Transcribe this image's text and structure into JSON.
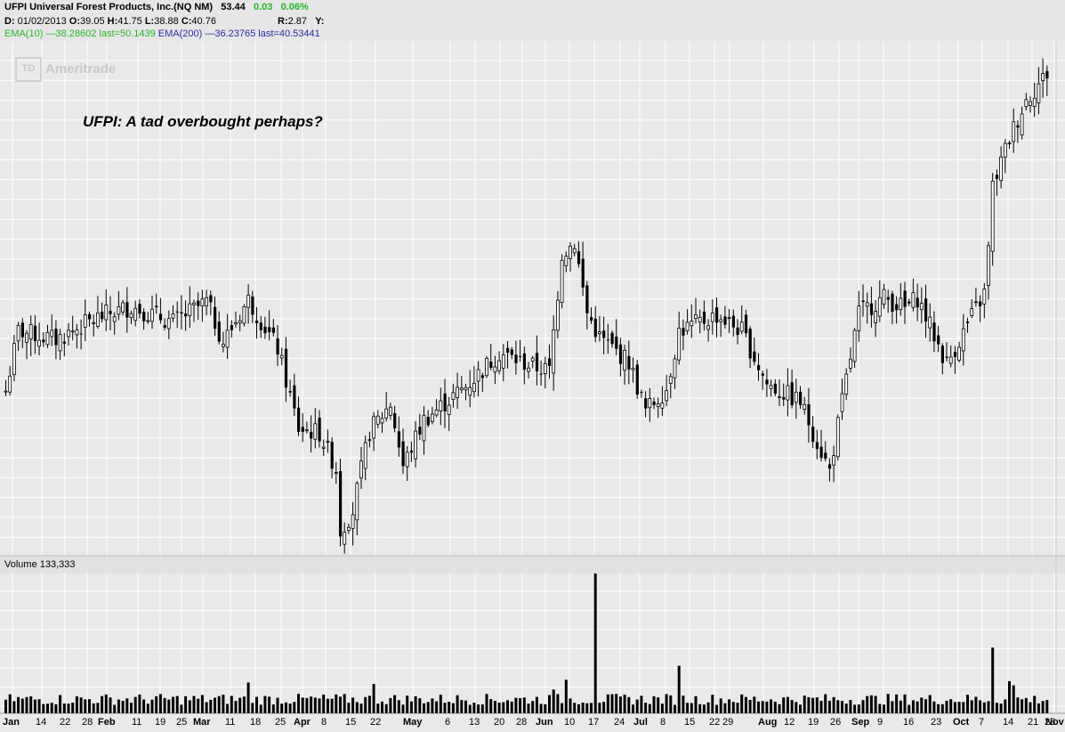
{
  "header": {
    "symbol_name": "UFPI Universal Forest Products, Inc.(NQ NM)",
    "last": "53.44",
    "change": "0.03",
    "change_pct": "0.06%",
    "d_label": "D:",
    "date": "01/02/2013",
    "o_label": "O:",
    "open": "39.05",
    "h_label": "H:",
    "high": "41.75",
    "l_label": "L:",
    "low": "38.88",
    "c_label": "C:",
    "close": "40.76",
    "r_label": "R:",
    "range": "2.87",
    "y_label": "Y:",
    "ema10_label": "EMA(10)",
    "ema10_value": "38.28602 last=50.1439",
    "ema200_label": "EMA(200)",
    "ema200_value": "36.23765 last=40.53441"
  },
  "watermark": {
    "logo_mark": "TD",
    "brand": "Ameritrade"
  },
  "annotation": "UFPI: A tad overbought perhaps?",
  "volume_label": "Volume 133,333",
  "colors": {
    "background": "#e9e9e9",
    "grid": "#ffffff",
    "candles": "#000000",
    "ema10": "#22b822",
    "ema200": "#2a2aa8"
  },
  "chart_data": {
    "type": "candlestick",
    "title": "UFPI Universal Forest Products, Inc.(NQ NM)",
    "grid": true,
    "y_axis_labels": false,
    "x_tick_labels": [
      "Jan",
      "14",
      "22",
      "28",
      "Feb",
      "11",
      "19",
      "25",
      "Mar",
      "11",
      "18",
      "25",
      "Apr",
      "8",
      "15",
      "22",
      "May",
      "6",
      "13",
      "20",
      "28",
      "Jun",
      "10",
      "17",
      "24",
      "Jul",
      "8",
      "15",
      "22",
      "29",
      "Aug",
      "12",
      "19",
      "26",
      "Sep",
      "9",
      "16",
      "23",
      "Oct",
      "7",
      "14",
      "21",
      "28",
      "Nov"
    ],
    "x_tick_month_labels": [
      "Jan",
      "Feb",
      "Mar",
      "Apr",
      "May",
      "Jun",
      "Jul",
      "Aug",
      "Sep",
      "Oct",
      "Nov"
    ],
    "first_bar": {
      "date": "01/02/2013",
      "open": 39.05,
      "high": 41.75,
      "low": 38.88,
      "close": 40.76
    },
    "last_price": 53.44,
    "close_path": [
      {
        "bar": 0,
        "close": 39.1
      },
      {
        "bar": 3,
        "close": 41.8
      },
      {
        "bar": 12,
        "close": 41.4
      },
      {
        "bar": 22,
        "close": 42.4
      },
      {
        "bar": 30,
        "close": 42.9
      },
      {
        "bar": 40,
        "close": 42.2
      },
      {
        "bar": 48,
        "close": 43.1
      },
      {
        "bar": 52,
        "close": 41.3
      },
      {
        "bar": 58,
        "close": 43.2
      },
      {
        "bar": 65,
        "close": 41.0
      },
      {
        "bar": 70,
        "close": 37.4
      },
      {
        "bar": 75,
        "close": 37.2
      },
      {
        "bar": 79,
        "close": 35.6
      },
      {
        "bar": 80,
        "close": 32.8
      },
      {
        "bar": 83,
        "close": 33.7
      },
      {
        "bar": 87,
        "close": 37.3
      },
      {
        "bar": 92,
        "close": 38.5
      },
      {
        "bar": 95,
        "close": 35.7
      },
      {
        "bar": 100,
        "close": 37.8
      },
      {
        "bar": 110,
        "close": 39.3
      },
      {
        "bar": 118,
        "close": 40.8
      },
      {
        "bar": 126,
        "close": 40.2
      },
      {
        "bar": 130,
        "close": 40.0
      },
      {
        "bar": 133,
        "close": 45.3
      },
      {
        "bar": 136,
        "close": 45.8
      },
      {
        "bar": 139,
        "close": 42.6
      },
      {
        "bar": 142,
        "close": 41.5
      },
      {
        "bar": 149,
        "close": 40.4
      },
      {
        "bar": 153,
        "close": 38.2
      },
      {
        "bar": 158,
        "close": 39.2
      },
      {
        "bar": 161,
        "close": 41.8
      },
      {
        "bar": 170,
        "close": 42.5
      },
      {
        "bar": 176,
        "close": 41.8
      },
      {
        "bar": 182,
        "close": 39.4
      },
      {
        "bar": 190,
        "close": 38.6
      },
      {
        "bar": 194,
        "close": 36.8
      },
      {
        "bar": 197,
        "close": 35.5
      },
      {
        "bar": 200,
        "close": 38.6
      },
      {
        "bar": 204,
        "close": 42.6
      },
      {
        "bar": 210,
        "close": 43.3
      },
      {
        "bar": 215,
        "close": 42.8
      },
      {
        "bar": 218,
        "close": 43.3
      },
      {
        "bar": 225,
        "close": 40.3
      },
      {
        "bar": 230,
        "close": 42.1
      },
      {
        "bar": 234,
        "close": 43.5
      },
      {
        "bar": 235,
        "close": 45.5
      },
      {
        "bar": 236,
        "close": 48.3
      },
      {
        "bar": 240,
        "close": 50.5
      },
      {
        "bar": 244,
        "close": 52.2
      },
      {
        "bar": 249,
        "close": 53.4
      }
    ],
    "volume_spikes": [
      {
        "bar": 141,
        "note": "largest volume bar"
      },
      {
        "bar": 236,
        "note": "second largest volume bar"
      }
    ]
  }
}
